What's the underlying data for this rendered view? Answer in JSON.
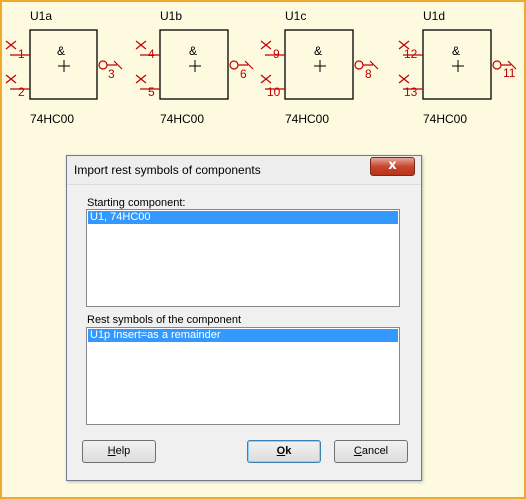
{
  "schematic": {
    "components": [
      {
        "ref": "U1a",
        "symbol": "&",
        "part": "74HC00",
        "pins": [
          "1",
          "2",
          "3"
        ]
      },
      {
        "ref": "U1b",
        "symbol": "&",
        "part": "74HC00",
        "pins": [
          "4",
          "5",
          "6"
        ]
      },
      {
        "ref": "U1c",
        "symbol": "&",
        "part": "74HC00",
        "pins": [
          "9",
          "10",
          "8"
        ]
      },
      {
        "ref": "U1d",
        "symbol": "&",
        "part": "74HC00",
        "pins": [
          "12",
          "13",
          "11"
        ]
      }
    ],
    "colors": {
      "border": "#f0a92f",
      "background": "#fdfae0",
      "pin": "#c00000",
      "body": "#000000"
    }
  },
  "dialog": {
    "title": "Import rest symbols of components",
    "close_glyph": "x",
    "starting_label": "Starting component:",
    "starting_items": [
      "U1, 74HC00"
    ],
    "rest_label": "Rest symbols of the component",
    "rest_items": [
      "U1p  Insert=as a remainder"
    ],
    "buttons": {
      "help": {
        "mnemonic": "H",
        "rest": "elp"
      },
      "ok": {
        "mnemonic": "O",
        "rest": "k"
      },
      "cancel": {
        "mnemonic": "C",
        "rest": "ancel"
      }
    },
    "selection_color": "#3399ff"
  }
}
